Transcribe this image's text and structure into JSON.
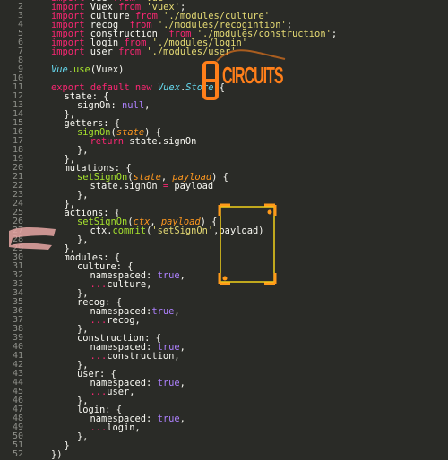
{
  "lines": [
    {
      "n": "1",
      "indent": 0,
      "tokens": [
        {
          "t": "import",
          "c": "kw"
        },
        {
          "t": " Vue "
        },
        {
          "t": "from",
          "c": "kw"
        },
        {
          "t": " "
        },
        {
          "t": "'vue'",
          "c": "str"
        }
      ]
    },
    {
      "n": "2",
      "indent": 0,
      "tokens": [
        {
          "t": "import",
          "c": "kw"
        },
        {
          "t": " Vuex "
        },
        {
          "t": "from",
          "c": "kw"
        },
        {
          "t": " "
        },
        {
          "t": "'vuex'",
          "c": "str"
        },
        {
          "t": ";"
        }
      ]
    },
    {
      "n": "3",
      "indent": 0,
      "tokens": [
        {
          "t": "import",
          "c": "kw"
        },
        {
          "t": " culture "
        },
        {
          "t": "from",
          "c": "kw"
        },
        {
          "t": " "
        },
        {
          "t": "'./modules/culture'",
          "c": "str"
        }
      ]
    },
    {
      "n": "4",
      "indent": 0,
      "tokens": [
        {
          "t": "import",
          "c": "kw"
        },
        {
          "t": " recog  "
        },
        {
          "t": "from",
          "c": "kw"
        },
        {
          "t": " "
        },
        {
          "t": "'./modules/recogintion'",
          "c": "str"
        },
        {
          "t": ";"
        }
      ]
    },
    {
      "n": "5",
      "indent": 0,
      "tokens": [
        {
          "t": "import",
          "c": "kw"
        },
        {
          "t": " construction  "
        },
        {
          "t": "from",
          "c": "kw"
        },
        {
          "t": " "
        },
        {
          "t": "'./modules/construction'",
          "c": "str"
        },
        {
          "t": ";"
        }
      ]
    },
    {
      "n": "6",
      "indent": 0,
      "tokens": [
        {
          "t": "import",
          "c": "kw"
        },
        {
          "t": " login "
        },
        {
          "t": "from",
          "c": "kw"
        },
        {
          "t": " "
        },
        {
          "t": "'./modules/login'",
          "c": "str"
        }
      ]
    },
    {
      "n": "7",
      "indent": 0,
      "tokens": [
        {
          "t": "import",
          "c": "kw"
        },
        {
          "t": " user "
        },
        {
          "t": "from",
          "c": "kw"
        },
        {
          "t": " "
        },
        {
          "t": "'./modules/user'",
          "c": "str"
        }
      ]
    },
    {
      "n": "8",
      "indent": 0,
      "tokens": []
    },
    {
      "n": "9",
      "indent": 0,
      "tokens": [
        {
          "t": "Vue",
          "c": "cls"
        },
        {
          "t": "."
        },
        {
          "t": "use",
          "c": "fn"
        },
        {
          "t": "(Vuex)"
        }
      ]
    },
    {
      "n": "10",
      "indent": 0,
      "tokens": []
    },
    {
      "n": "11",
      "indent": 0,
      "tokens": [
        {
          "t": "export",
          "c": "kw"
        },
        {
          "t": " "
        },
        {
          "t": "default",
          "c": "kw"
        },
        {
          "t": " "
        },
        {
          "t": "new",
          "c": "kw"
        },
        {
          "t": " "
        },
        {
          "t": "Vuex",
          "c": "cls"
        },
        {
          "t": "."
        },
        {
          "t": "Store",
          "c": "cls"
        },
        {
          "t": "({"
        }
      ]
    },
    {
      "n": "12",
      "indent": 1,
      "tokens": [
        {
          "t": "state: {"
        }
      ]
    },
    {
      "n": "13",
      "indent": 2,
      "tokens": [
        {
          "t": "signOn: "
        },
        {
          "t": "null",
          "c": "num"
        },
        {
          "t": ","
        }
      ]
    },
    {
      "n": "14",
      "indent": 1,
      "tokens": [
        {
          "t": "},"
        }
      ]
    },
    {
      "n": "15",
      "indent": 1,
      "tokens": [
        {
          "t": "getters: {"
        }
      ]
    },
    {
      "n": "16",
      "indent": 2,
      "tokens": [
        {
          "t": "signOn",
          "c": "fn"
        },
        {
          "t": "("
        },
        {
          "t": "state",
          "c": "param"
        },
        {
          "t": ") {"
        }
      ]
    },
    {
      "n": "17",
      "indent": 3,
      "tokens": [
        {
          "t": "return",
          "c": "kw"
        },
        {
          "t": " state.signOn"
        }
      ]
    },
    {
      "n": "18",
      "indent": 2,
      "tokens": [
        {
          "t": "},"
        }
      ]
    },
    {
      "n": "19",
      "indent": 1,
      "tokens": [
        {
          "t": "},"
        }
      ]
    },
    {
      "n": "20",
      "indent": 1,
      "tokens": [
        {
          "t": "mutations: {"
        }
      ]
    },
    {
      "n": "21",
      "indent": 2,
      "tokens": [
        {
          "t": "setSignOn",
          "c": "fn"
        },
        {
          "t": "("
        },
        {
          "t": "state",
          "c": "param"
        },
        {
          "t": ", "
        },
        {
          "t": "payload",
          "c": "param"
        },
        {
          "t": ") {"
        }
      ]
    },
    {
      "n": "22",
      "indent": 3,
      "tokens": [
        {
          "t": "state.signOn "
        },
        {
          "t": "=",
          "c": "kw"
        },
        {
          "t": " payload"
        }
      ]
    },
    {
      "n": "23",
      "indent": 2,
      "tokens": [
        {
          "t": "},"
        }
      ]
    },
    {
      "n": "24",
      "indent": 1,
      "tokens": [
        {
          "t": "},"
        }
      ]
    },
    {
      "n": "25",
      "indent": 1,
      "tokens": [
        {
          "t": "actions: {"
        }
      ]
    },
    {
      "n": "26",
      "indent": 2,
      "tokens": [
        {
          "t": "setSignOn",
          "c": "fn"
        },
        {
          "t": "("
        },
        {
          "t": "ctx",
          "c": "param"
        },
        {
          "t": ", "
        },
        {
          "t": "payload",
          "c": "param"
        },
        {
          "t": ") {"
        }
      ]
    },
    {
      "n": "27",
      "indent": 3,
      "tokens": [
        {
          "t": "ctx."
        },
        {
          "t": "commit",
          "c": "fn"
        },
        {
          "t": "("
        },
        {
          "t": "'setSignOn'",
          "c": "str"
        },
        {
          "t": ",payload)"
        }
      ]
    },
    {
      "n": "28",
      "indent": 2,
      "tokens": [
        {
          "t": "},"
        }
      ]
    },
    {
      "n": "29",
      "indent": 1,
      "tokens": [
        {
          "t": "},"
        }
      ]
    },
    {
      "n": "30",
      "indent": 1,
      "tokens": [
        {
          "t": "modules: {"
        }
      ]
    },
    {
      "n": "31",
      "indent": 2,
      "tokens": [
        {
          "t": "culture: {"
        }
      ]
    },
    {
      "n": "32",
      "indent": 3,
      "tokens": [
        {
          "t": "namespaced: "
        },
        {
          "t": "true",
          "c": "num"
        },
        {
          "t": ","
        }
      ]
    },
    {
      "n": "33",
      "indent": 3,
      "tokens": [
        {
          "t": "...",
          "c": "kw"
        },
        {
          "t": "culture,"
        }
      ]
    },
    {
      "n": "34",
      "indent": 2,
      "tokens": [
        {
          "t": "},"
        }
      ]
    },
    {
      "n": "35",
      "indent": 2,
      "tokens": [
        {
          "t": "recog: {"
        }
      ]
    },
    {
      "n": "36",
      "indent": 3,
      "tokens": [
        {
          "t": "namespaced:"
        },
        {
          "t": "true",
          "c": "num"
        },
        {
          "t": ","
        }
      ]
    },
    {
      "n": "37",
      "indent": 3,
      "tokens": [
        {
          "t": "...",
          "c": "kw"
        },
        {
          "t": "recog,"
        }
      ]
    },
    {
      "n": "38",
      "indent": 2,
      "tokens": [
        {
          "t": "},"
        }
      ]
    },
    {
      "n": "39",
      "indent": 2,
      "tokens": [
        {
          "t": "construction: {"
        }
      ]
    },
    {
      "n": "40",
      "indent": 3,
      "tokens": [
        {
          "t": "namespaced: "
        },
        {
          "t": "true",
          "c": "num"
        },
        {
          "t": ","
        }
      ]
    },
    {
      "n": "41",
      "indent": 3,
      "tokens": [
        {
          "t": "...",
          "c": "kw"
        },
        {
          "t": "construction,"
        }
      ]
    },
    {
      "n": "42",
      "indent": 2,
      "tokens": [
        {
          "t": "},"
        }
      ]
    },
    {
      "n": "43",
      "indent": 2,
      "tokens": [
        {
          "t": "user: {"
        }
      ]
    },
    {
      "n": "44",
      "indent": 3,
      "tokens": [
        {
          "t": "namespaced: "
        },
        {
          "t": "true",
          "c": "num"
        },
        {
          "t": ","
        }
      ]
    },
    {
      "n": "45",
      "indent": 3,
      "tokens": [
        {
          "t": "...",
          "c": "kw"
        },
        {
          "t": "user,"
        }
      ]
    },
    {
      "n": "46",
      "indent": 2,
      "tokens": [
        {
          "t": "},"
        }
      ]
    },
    {
      "n": "47",
      "indent": 2,
      "tokens": [
        {
          "t": "login: {"
        }
      ]
    },
    {
      "n": "48",
      "indent": 3,
      "tokens": [
        {
          "t": "namespaced: "
        },
        {
          "t": "true",
          "c": "num"
        },
        {
          "t": ","
        }
      ]
    },
    {
      "n": "49",
      "indent": 3,
      "tokens": [
        {
          "t": "...",
          "c": "kw"
        },
        {
          "t": "login,"
        }
      ]
    },
    {
      "n": "50",
      "indent": 2,
      "tokens": [
        {
          "t": "},"
        }
      ]
    },
    {
      "n": "51",
      "indent": 1,
      "tokens": [
        {
          "t": "}"
        }
      ]
    },
    {
      "n": "52",
      "indent": 0,
      "tokens": [
        {
          "t": "})"
        }
      ]
    }
  ],
  "overlay": {
    "logo_line1": "E",
    "logo_line2": "CIRCUITS"
  },
  "colors": {
    "background": "#2a2b27",
    "text": "#f8f8f2",
    "keyword": "#f92672",
    "string": "#e6db74",
    "class": "#66d9ef",
    "function": "#a6e22e",
    "param": "#fd971f",
    "number": "#ae81ff",
    "line_number": "#8f908a",
    "logo": "#ff7f1a",
    "bracket": "#f2d21a",
    "smudge": "#e8a7a4"
  }
}
